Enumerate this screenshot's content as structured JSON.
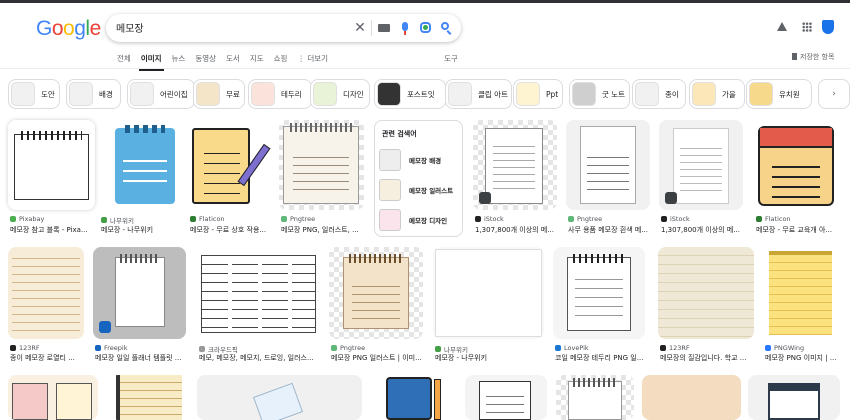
{
  "search": {
    "query": "메모장"
  },
  "logo": {
    "letters": [
      "G",
      "o",
      "o",
      "g",
      "l",
      "e"
    ],
    "colors": [
      "#4285f4",
      "#ea4335",
      "#fbbc05",
      "#4285f4",
      "#34a853",
      "#ea4335"
    ]
  },
  "nav": {
    "tabs": [
      "전체",
      "이미지",
      "뉴스",
      "동영상",
      "도서",
      "지도",
      "쇼핑",
      "⋮ 더보기"
    ],
    "tools": "도구",
    "saved": "저장한 항목"
  },
  "chips": [
    "도안",
    "배경",
    "어린이집",
    "무료",
    "테두리",
    "디자인",
    "포스트잇",
    "클립 아트",
    "Ppt",
    "굿 노트",
    "종이",
    "가을",
    "유치원"
  ],
  "related": {
    "title": "관련 검색어",
    "items": [
      "메모장 배경",
      "메모장 일러스트",
      "메모장 디자인"
    ]
  },
  "row1": [
    {
      "source": "Pixabay",
      "title": "메모장 참고 블록 - Pixa...",
      "fav": "#4caf50"
    },
    {
      "source": "나무위키",
      "title": "메모장 - 나무위키",
      "fav": "#43a047"
    },
    {
      "source": "Flaticon",
      "title": "메모장 - 무료 상호 작용...",
      "fav": "#2e7d32"
    },
    {
      "source": "Pngtree",
      "title": "메모장 PNG, 일러스트, ...",
      "fav": "#5fb878"
    },
    {
      "source": "iStock",
      "title": "1,307,800개 이상의 메...",
      "fav": "#222"
    },
    {
      "source": "Pngtree",
      "title": "사무 용품 메모장 흰색 메...",
      "fav": "#5fb878"
    },
    {
      "source": "iStock",
      "title": "1,307,800개 이상의 메...",
      "fav": "#222"
    },
    {
      "source": "Flaticon",
      "title": "메모장 - 무료 교육개 아...",
      "fav": "#2e7d32"
    }
  ],
  "row2": [
    {
      "source": "123RF",
      "title": "종이 메모장 로열티 ...",
      "fav": "#222"
    },
    {
      "source": "Freepik",
      "title": "메모장 일일 플래너 템플릿 ...",
      "fav": "#1565c0"
    },
    {
      "source": "크라우드픽",
      "title": "메모, 메모장, 메모지, 드로잉, 일러스...",
      "fav": "#999"
    },
    {
      "source": "Pngtree",
      "title": "메모장 PNG 일러스트 | 이미...",
      "fav": "#5fb878"
    },
    {
      "source": "나무위키",
      "title": "메모장 - 나무위키",
      "fav": "#43a047"
    },
    {
      "source": "LovePik",
      "title": "코일 메모장 테두리 PNG 일...",
      "fav": "#1976d2"
    },
    {
      "source": "123RF",
      "title": "메모장의 질감입니다. 학교 ...",
      "fav": "#222"
    },
    {
      "source": "PNGWing",
      "title": "메모장 PNG 이미지 | ...",
      "fav": "#2979ff"
    }
  ]
}
